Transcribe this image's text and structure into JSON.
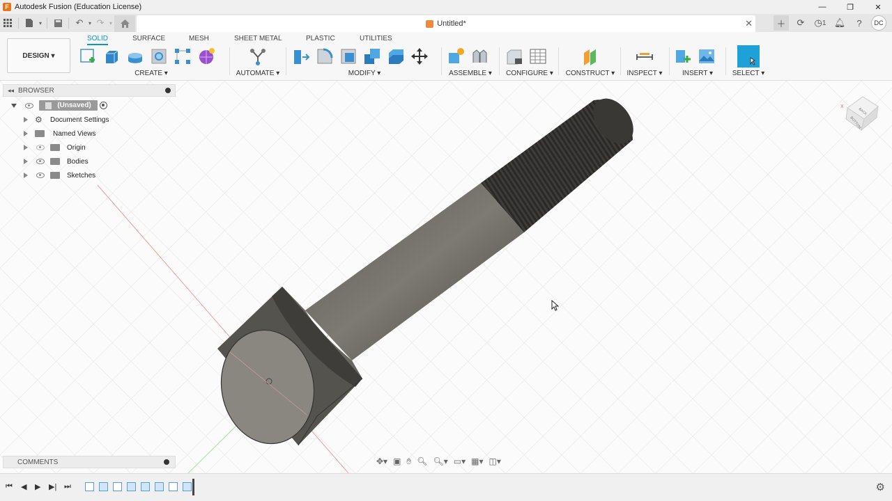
{
  "window": {
    "title": "Autodesk Fusion (Education License)"
  },
  "document_tab": {
    "title": "Untitled*"
  },
  "user": {
    "initials": "DC"
  },
  "job_status": {
    "count": "1"
  },
  "ribbon": {
    "workspace": "DESIGN ▾",
    "tabs": [
      "SOLID",
      "SURFACE",
      "MESH",
      "SHEET METAL",
      "PLASTIC",
      "UTILITIES"
    ],
    "active_tab": "SOLID",
    "groups": {
      "create": "CREATE ▾",
      "automate": "AUTOMATE ▾",
      "modify": "MODIFY ▾",
      "assemble": "ASSEMBLE ▾",
      "configure": "CONFIGURE ▾",
      "construct": "CONSTRUCT ▾",
      "inspect": "INSPECT ▾",
      "insert": "INSERT ▾",
      "select": "SELECT ▾"
    }
  },
  "browser": {
    "header": "BROWSER",
    "root": "(Unsaved)",
    "items": [
      "Document Settings",
      "Named Views",
      "Origin",
      "Bodies",
      "Sketches"
    ]
  },
  "comments": {
    "header": "COMMENTS"
  },
  "colors": {
    "accent": "#0696d7",
    "select_button": "#1ea0d8",
    "model": "#6d6a63"
  },
  "icons": {
    "grid_menu": "grid-icon",
    "file": "file-icon",
    "save": "save-icon",
    "undo": "undo-icon",
    "redo": "redo-icon",
    "home": "home-icon",
    "close": "close-icon",
    "new_tab": "plus-icon",
    "online": "sync-icon",
    "jobs": "clock-icon",
    "notifications": "bell-icon",
    "help": "help-icon",
    "settings": "gear-icon"
  }
}
